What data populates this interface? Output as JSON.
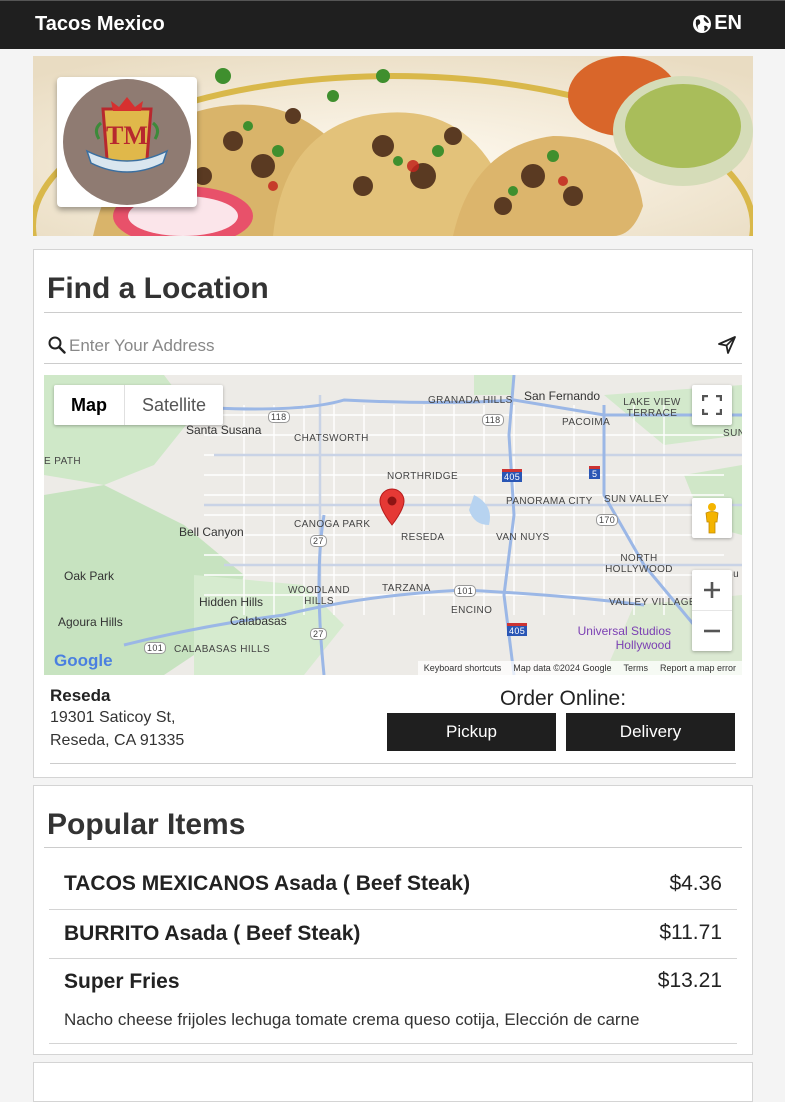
{
  "header": {
    "brand": "Tacos Mexico",
    "lang": "EN",
    "globe_icon": "globe-icon"
  },
  "find": {
    "title": "Find a Location",
    "search_placeholder": "Enter Your Address",
    "search_icon": "search-icon",
    "locate_icon": "location-arrow-icon"
  },
  "map": {
    "tabs": [
      "Map",
      "Satellite"
    ],
    "labels": {
      "granada_hills": "GRANADA HILLS",
      "san_fernando": "San Fernando",
      "lake_view_terrace": "LAKE VIEW TERRACE",
      "santa_susana": "Santa Susana",
      "chatsworth": "CHATSWORTH",
      "pacoima": "PACOIMA",
      "sun": "SUN",
      "path": "E PATH",
      "northridge": "NORTHRIDGE",
      "panorama_city": "PANORAMA CITY",
      "sun_valley": "SUN VALLEY",
      "bell_canyon": "Bell Canyon",
      "canoga_park": "CANOGA PARK",
      "reseda": "RESEDA",
      "van_nuys": "VAN NUYS",
      "north_hollywood": "NORTH HOLLYWOOD",
      "oak_park": "Oak Park",
      "woodland_hills": "WOODLAND HILLS",
      "tarzana": "TARZANA",
      "hidden_hills": "Hidden Hills",
      "valley_village": "VALLEY VILLAGE",
      "encino": "ENCINO",
      "agoura_hills": "Agoura Hills",
      "calabasas": "Calabasas",
      "universal_studios": "Universal Studios Hollywood",
      "calabasas_hills": "CALABASAS HILLS",
      "bu": "Bu",
      "shield_118a": "118",
      "shield_118b": "118",
      "shield_405a": "405",
      "shield_5": "5",
      "shield_170": "170",
      "shield_27a": "27",
      "shield_101a": "101",
      "shield_27b": "27",
      "shield_101b": "101",
      "shield_405b": "405"
    },
    "google": "Google",
    "footer": [
      "Keyboard shortcuts",
      "Map data ©2024 Google",
      "Terms",
      "Report a map error"
    ],
    "icons": {
      "fullscreen": "fullscreen-icon",
      "pegman": "pegman-icon",
      "zoom_in": "zoom-in-icon",
      "zoom_out": "zoom-out-icon",
      "marker": "map-marker-icon"
    }
  },
  "location": {
    "name": "Reseda",
    "address1": "19301 Saticoy St,",
    "address2": "Reseda, CA 91335",
    "order_title": "Order Online:",
    "pickup": "Pickup",
    "delivery": "Delivery"
  },
  "popular": {
    "title": "Popular Items",
    "items": [
      {
        "name": "TACOS MEXICANOS Asada ( Beef Steak)",
        "price": "$4.36"
      },
      {
        "name": "BURRITO Asada ( Beef Steak)",
        "price": "$11.71"
      },
      {
        "name": "Super Fries",
        "price": "$13.21",
        "desc": "Nacho cheese frijoles lechuga tomate crema queso cotija, Elección de carne"
      }
    ]
  },
  "colors": {
    "topbar": "#1f1f1f",
    "button": "#1f1f1f",
    "marker": "#e53935",
    "freeway": "#9bb7e6"
  }
}
